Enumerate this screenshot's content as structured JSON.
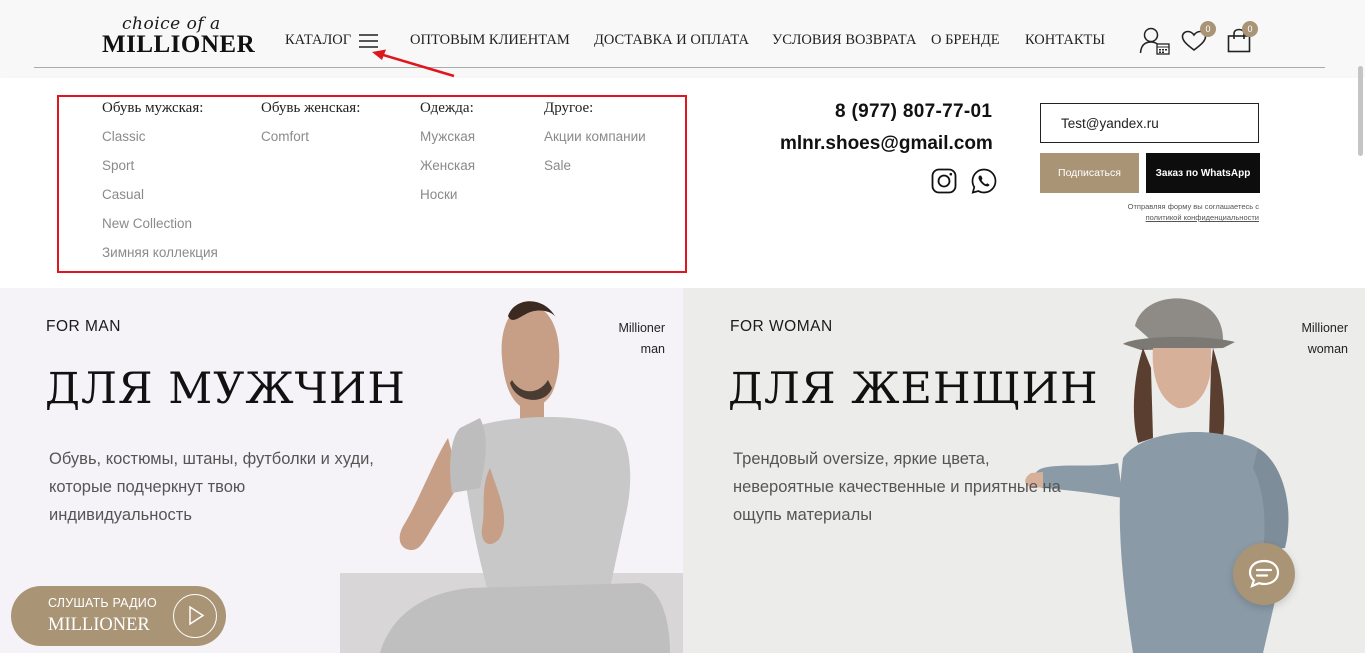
{
  "logo": {
    "script": "choice of a",
    "main": "MILLIONER"
  },
  "nav": {
    "items": [
      {
        "label": "КАТАЛОГ"
      },
      {
        "label": "ОПТОВЫМ КЛИЕНТАМ"
      },
      {
        "label": "ДОСТАВКА И ОПЛАТА"
      },
      {
        "label": "УСЛОВИЯ ВОЗВРАТА"
      },
      {
        "label": "О БРЕНДЕ"
      },
      {
        "label": "КОНТАКТЫ"
      }
    ],
    "favorites_count": "0",
    "cart_count": "0"
  },
  "catalog": {
    "columns": [
      {
        "title": "Обувь мужская:",
        "links": [
          "Classic",
          "Sport",
          "Casual",
          "New Collection",
          "Зимняя коллекция"
        ]
      },
      {
        "title": "Обувь женская:",
        "links": [
          "Comfort"
        ]
      },
      {
        "title": "Одежда:",
        "links": [
          "Мужская",
          "Женская",
          "Носки"
        ]
      },
      {
        "title": "Другое:",
        "links": [
          "Акции компании",
          "Sale"
        ]
      }
    ]
  },
  "contacts": {
    "phone": "8 (977) 807-77-01",
    "email": "mlnr.shoes@gmail.com"
  },
  "subscribe": {
    "input_value": "Test@yandex.ru",
    "subscribe_label": "Подписаться",
    "whatsapp_label": "Заказ по WhatsApp",
    "policy_text": "Отправляя форму вы соглашаетесь с",
    "policy_link": "политикой конфиденциальности"
  },
  "hero": {
    "left": {
      "eyebrow": "FOR MAN",
      "tag_line1": "Millioner",
      "tag_line2": "man",
      "title": "ДЛЯ МУЖЧИН",
      "text": "Обувь, костюмы, штаны, футболки и худи, которые подчеркнут твою индивидуальность"
    },
    "right": {
      "eyebrow": "FOR WOMAN",
      "tag_line1": "Millioner",
      "tag_line2": "woman",
      "title": "ДЛЯ ЖЕНЩИН",
      "text": "Трендовый oversize, яркие цвета, невероятные качественные и приятные на ощупь материалы"
    }
  },
  "radio": {
    "top": "СЛУШАТЬ РАДИО",
    "bottom": "MILLIONER"
  },
  "colors": {
    "accent": "#a99576",
    "highlight": "#e0161e",
    "dark": "#0d0d0d"
  },
  "icons": [
    "menu-icon",
    "account-icon",
    "heart-icon",
    "bag-icon",
    "instagram-icon",
    "whatsapp-icon",
    "play-icon",
    "chat-icon"
  ]
}
